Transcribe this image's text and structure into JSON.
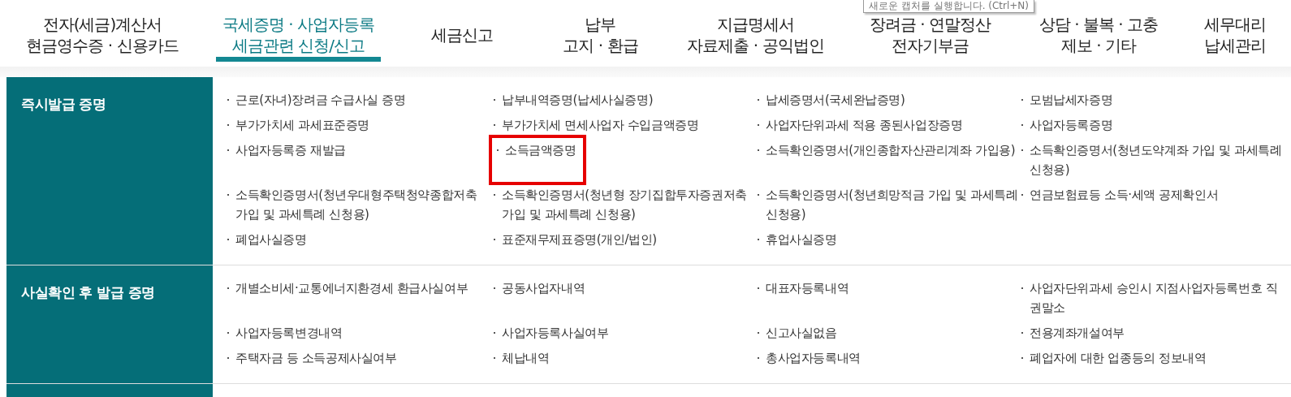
{
  "nav": {
    "tabs": [
      {
        "label": "전자(세금)계산서\n현금영수증 · 신용카드",
        "selected": false
      },
      {
        "label": "국세증명 · 사업자등록\n세금관련 신청/신고",
        "selected": true
      },
      {
        "label": "세금신고",
        "selected": false
      },
      {
        "label": "납부\n고지 · 환급",
        "selected": false
      },
      {
        "label": "지급명세서\n자료제출 · 공익법인",
        "selected": false
      },
      {
        "label": "장려금 · 연말정산\n전자기부금",
        "selected": false
      },
      {
        "label": "상담 · 불복 · 고충\n제보 · 기타",
        "selected": false
      },
      {
        "label": "세무대리\n납세관리",
        "selected": false
      }
    ]
  },
  "tooltip": {
    "text": "새로운 캡처를 실행합니다. (Ctrl+N)"
  },
  "sections": [
    {
      "title": "즉시발급 증명",
      "items": [
        {
          "label": "근로(자녀)장려금 수급사실 증명",
          "highlighted": false
        },
        {
          "label": "납부내역증명(납세사실증명)",
          "highlighted": false
        },
        {
          "label": "납세증명서(국세완납증명)",
          "highlighted": false
        },
        {
          "label": "모범납세자증명",
          "highlighted": false
        },
        {
          "label": "부가가치세 과세표준증명",
          "highlighted": false
        },
        {
          "label": "부가가치세 면세사업자 수입금액증명",
          "highlighted": false
        },
        {
          "label": "사업자단위과세 적용 종된사업장증명",
          "highlighted": false
        },
        {
          "label": "사업자등록증명",
          "highlighted": false
        },
        {
          "label": "사업자등록증 재발급",
          "highlighted": false
        },
        {
          "label": "소득금액증명",
          "highlighted": true
        },
        {
          "label": "소득확인증명서(개인종합자산관리계좌 가입용)",
          "highlighted": false
        },
        {
          "label": "소득확인증명서(청년도약계좌 가입 및 과세특례 신청용)",
          "highlighted": false
        },
        {
          "label": "소득확인증명서(청년우대형주택청약종합저축 가입 및 과세특례 신청용)",
          "highlighted": false
        },
        {
          "label": "소득확인증명서(청년형 장기집합투자증권저축 가입 및 과세특례 신청용)",
          "highlighted": false
        },
        {
          "label": "소득확인증명서(청년희망적금 가입 및 과세특례 신청용)",
          "highlighted": false
        },
        {
          "label": "연금보험료등 소득·세액 공제확인서",
          "highlighted": false
        },
        {
          "label": "폐업사실증명",
          "highlighted": false
        },
        {
          "label": "표준재무제표증명(개인/법인)",
          "highlighted": false
        },
        {
          "label": "휴업사실증명",
          "highlighted": false
        }
      ]
    },
    {
      "title": "사실확인 후 발급 증명",
      "items": [
        {
          "label": "개별소비세·교통에너지환경세 환급사실여부",
          "highlighted": false
        },
        {
          "label": "공동사업자내역",
          "highlighted": false
        },
        {
          "label": "대표자등록내역",
          "highlighted": false
        },
        {
          "label": "사업자단위과세 승인시 지점사업자등록번호 직권말소",
          "highlighted": false
        },
        {
          "label": "사업자등록변경내역",
          "highlighted": false
        },
        {
          "label": "사업자등록사실여부",
          "highlighted": false
        },
        {
          "label": "신고사실없음",
          "highlighted": false
        },
        {
          "label": "전용계좌개설여부",
          "highlighted": false
        },
        {
          "label": "주택자금 등 소득공제사실여부",
          "highlighted": false
        },
        {
          "label": "체납내역",
          "highlighted": false
        },
        {
          "label": "총사업자등록내역",
          "highlighted": false
        },
        {
          "label": "폐업자에 대한 업종등의 정보내역",
          "highlighted": false
        }
      ]
    }
  ]
}
